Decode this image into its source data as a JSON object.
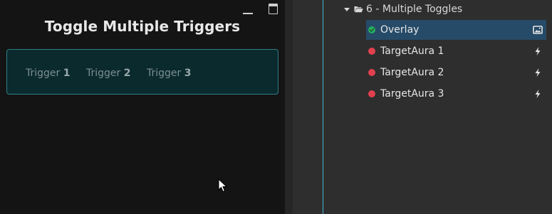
{
  "preview": {
    "title": "Toggle Multiple Triggers",
    "triggers": [
      {
        "label": "Trigger",
        "number": "1"
      },
      {
        "label": "Trigger",
        "number": "2"
      },
      {
        "label": "Trigger",
        "number": "3"
      }
    ]
  },
  "tree": {
    "group": {
      "label": "6 - Multiple Toggles",
      "icon": "folder-open-icon",
      "expanded": true
    },
    "items": [
      {
        "label": "Overlay",
        "status": "ok",
        "status_color": "#27ae60",
        "type_icon": "image-icon",
        "selected": true
      },
      {
        "label": "TargetAura 1",
        "status": "error",
        "status_color": "#e2404f",
        "type_icon": "lightning-icon",
        "selected": false
      },
      {
        "label": "TargetAura 2",
        "status": "error",
        "status_color": "#e2404f",
        "type_icon": "lightning-icon",
        "selected": false
      },
      {
        "label": "TargetAura 3",
        "status": "error",
        "status_color": "#e2404f",
        "type_icon": "lightning-icon",
        "selected": false
      }
    ]
  },
  "colors": {
    "accent": "#3fb7d4",
    "selection": "#264b68",
    "trigger_box_bg": "#0a2a2e",
    "trigger_box_border": "#2f7e85"
  }
}
